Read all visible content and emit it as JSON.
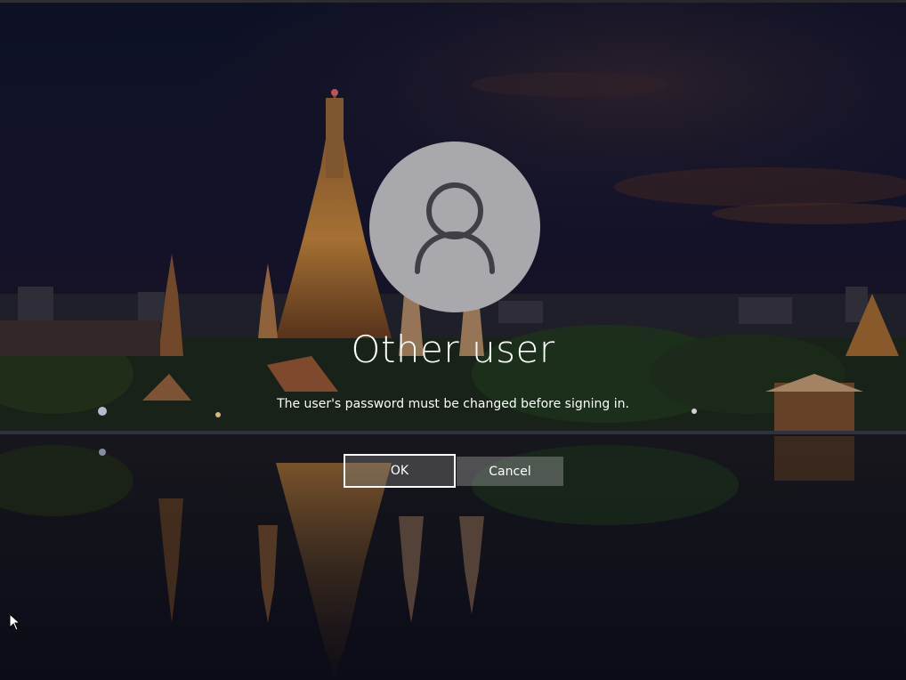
{
  "login": {
    "username": "Other user",
    "message": "The user's password must be changed before signing in.",
    "ok_label": "OK",
    "cancel_label": "Cancel"
  },
  "icons": {
    "avatar": "user-silhouette-icon",
    "cursor": "mouse-pointer-icon"
  },
  "colors": {
    "avatar_background": "#a9a8ad",
    "avatar_glyph": "#3f4046",
    "text": "#ffffff",
    "ok_border": "#ffffff"
  }
}
